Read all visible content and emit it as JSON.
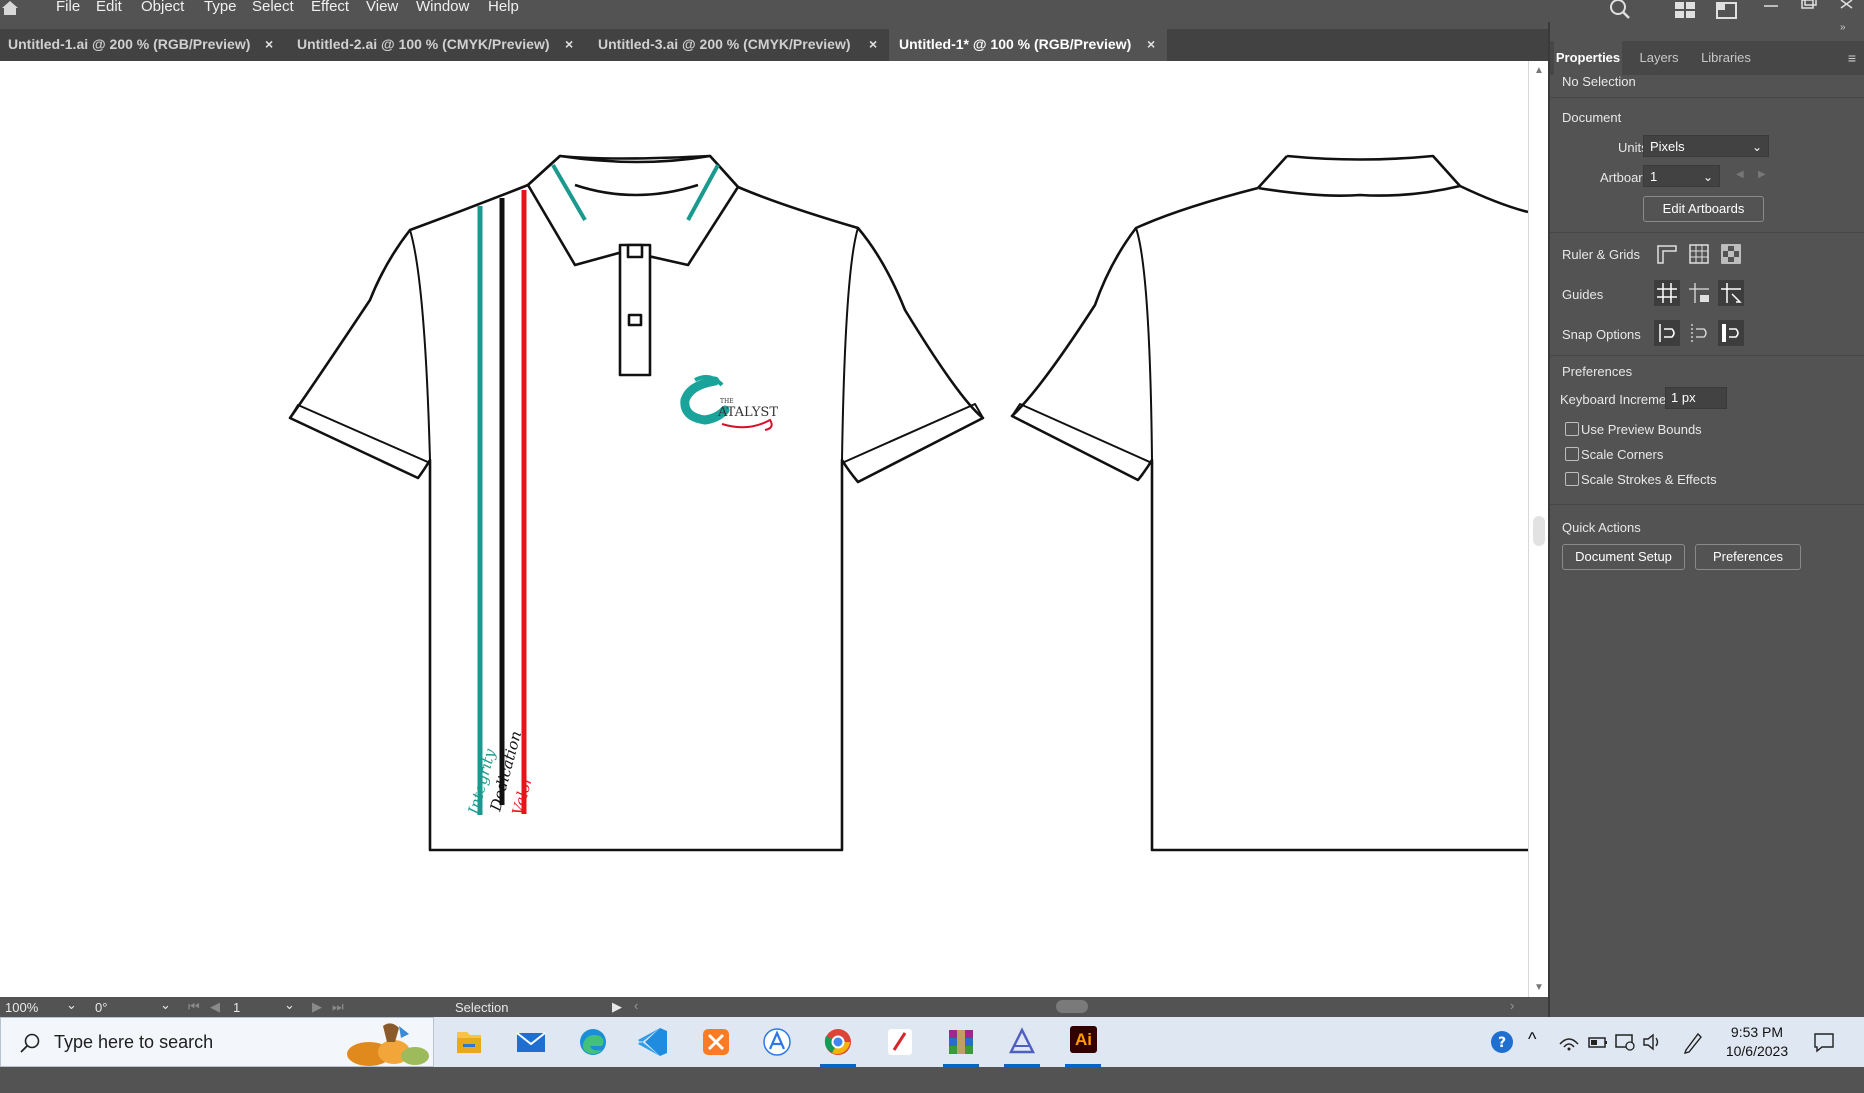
{
  "menubar": {
    "items": [
      "File",
      "Edit",
      "Object",
      "Type",
      "Select",
      "Effect",
      "View",
      "Window",
      "Help"
    ]
  },
  "tabs": [
    {
      "label": "Untitled-1.ai @ 200 % (RGB/Preview)",
      "active": false
    },
    {
      "label": "Untitled-2.ai @ 100 % (CMYK/Preview)",
      "active": false
    },
    {
      "label": "Untitled-3.ai @ 200 % (CMYK/Preview)",
      "active": false
    },
    {
      "label": "Untitled-1* @ 100 % (RGB/Preview)",
      "active": true
    }
  ],
  "tab_close_glyph": "×",
  "artwork": {
    "stripe_words": [
      "Integrity",
      "Dedication",
      "Valor"
    ],
    "stripe_colors": [
      "#1a9a8e",
      "#111111",
      "#e8141b"
    ],
    "logo_small": "THE",
    "logo_text": "ATALYST",
    "logo_color": "#1aa39a",
    "logo_swoosh_color": "#d4102a"
  },
  "panel": {
    "tabs": [
      "Properties",
      "Layers",
      "Libraries"
    ],
    "selection_status": "No Selection",
    "document": {
      "heading": "Document",
      "units_label": "Units:",
      "units_value": "Pixels",
      "artboard_label": "Artboard:",
      "artboard_value": "1",
      "edit_artboards": "Edit Artboards"
    },
    "ruler_grids": "Ruler & Grids",
    "guides": "Guides",
    "snap_options": "Snap Options",
    "preferences": {
      "heading": "Preferences",
      "keyboard_increment_label": "Keyboard Increment:",
      "keyboard_increment_value": "1 px",
      "checkboxes": [
        {
          "label": "Use Preview Bounds",
          "checked": false
        },
        {
          "label": "Scale Corners",
          "checked": false
        },
        {
          "label": "Scale Strokes & Effects",
          "checked": false
        }
      ]
    },
    "quick_actions": {
      "heading": "Quick Actions",
      "document_setup": "Document Setup",
      "preferences": "Preferences"
    }
  },
  "statusbar": {
    "zoom": "100%",
    "rotation": "0°",
    "artboard": "1",
    "tool": "Selection"
  },
  "taskbar": {
    "search_placeholder": "Type here to search",
    "time": "9:53 PM",
    "date": "10/6/2023",
    "illustrator_label": "Ai"
  }
}
